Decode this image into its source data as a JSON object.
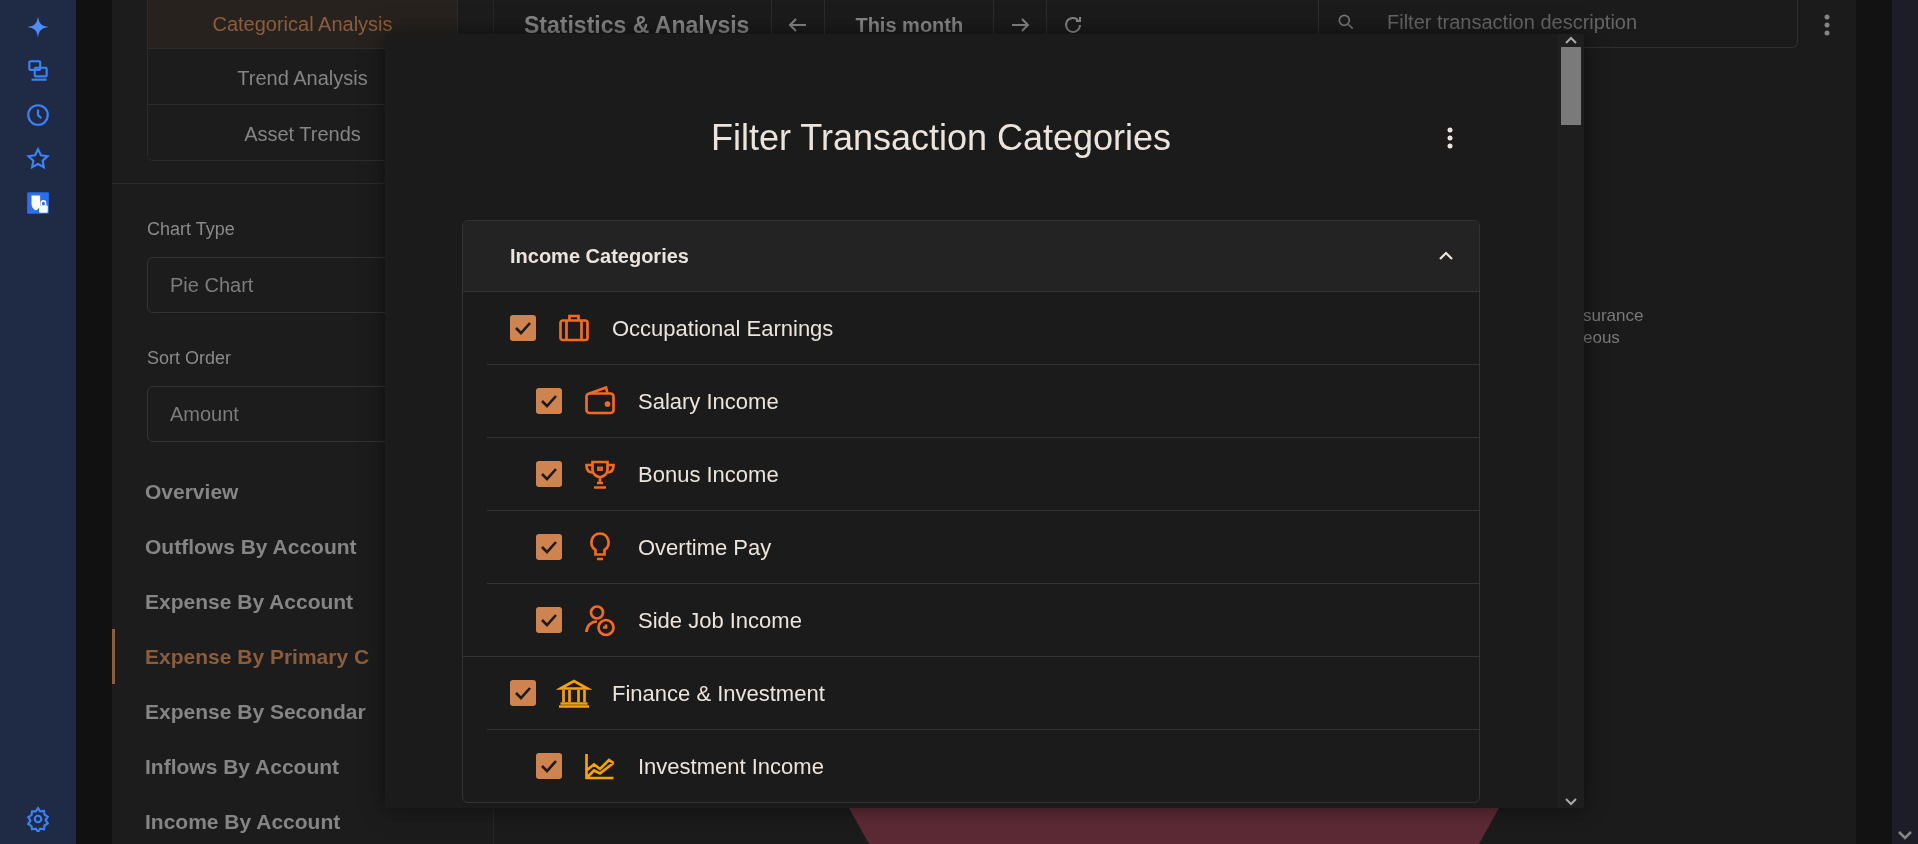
{
  "sidebar": {
    "tabs": [
      {
        "label": "Categorical Analysis",
        "selected": true
      },
      {
        "label": "Trend Analysis",
        "selected": false
      },
      {
        "label": "Asset Trends",
        "selected": false
      }
    ],
    "fields": [
      {
        "label": "Chart Type",
        "value": "Pie Chart"
      },
      {
        "label": "Sort Order",
        "value": "Amount"
      }
    ],
    "reports": [
      {
        "label": "Overview",
        "selected": false
      },
      {
        "label": "Outflows By Account",
        "selected": false
      },
      {
        "label": "Expense By Account",
        "selected": false
      },
      {
        "label": "Expense By Primary C",
        "selected": true
      },
      {
        "label": "Expense By Secondar",
        "selected": false
      },
      {
        "label": "Inflows By Account",
        "selected": false
      },
      {
        "label": "Income By Account",
        "selected": false
      }
    ]
  },
  "toolbar": {
    "title": "Statistics & Analysis",
    "period": "This month",
    "search": {
      "placeholder": "Filter transaction description"
    }
  },
  "chart": {
    "legend": [
      "surance",
      "eous"
    ]
  },
  "dialog": {
    "title": "Filter Transaction Categories",
    "sections": [
      {
        "title": "Income Categories",
        "expanded": true,
        "items": [
          {
            "name": "Occupational Earnings",
            "checked": true,
            "color": "#f26b21",
            "children": [
              {
                "name": "Salary Income",
                "checked": true,
                "color": "#f26b21"
              },
              {
                "name": "Bonus Income",
                "checked": true,
                "color": "#f26b21"
              },
              {
                "name": "Overtime Pay",
                "checked": true,
                "color": "#f26b21"
              },
              {
                "name": "Side Job Income",
                "checked": true,
                "color": "#f26b21"
              }
            ]
          },
          {
            "name": "Finance & Investment",
            "checked": true,
            "color": "#f5a300",
            "children": [
              {
                "name": "Investment Income",
                "checked": true,
                "color": "#f5a300"
              }
            ]
          }
        ]
      }
    ]
  }
}
